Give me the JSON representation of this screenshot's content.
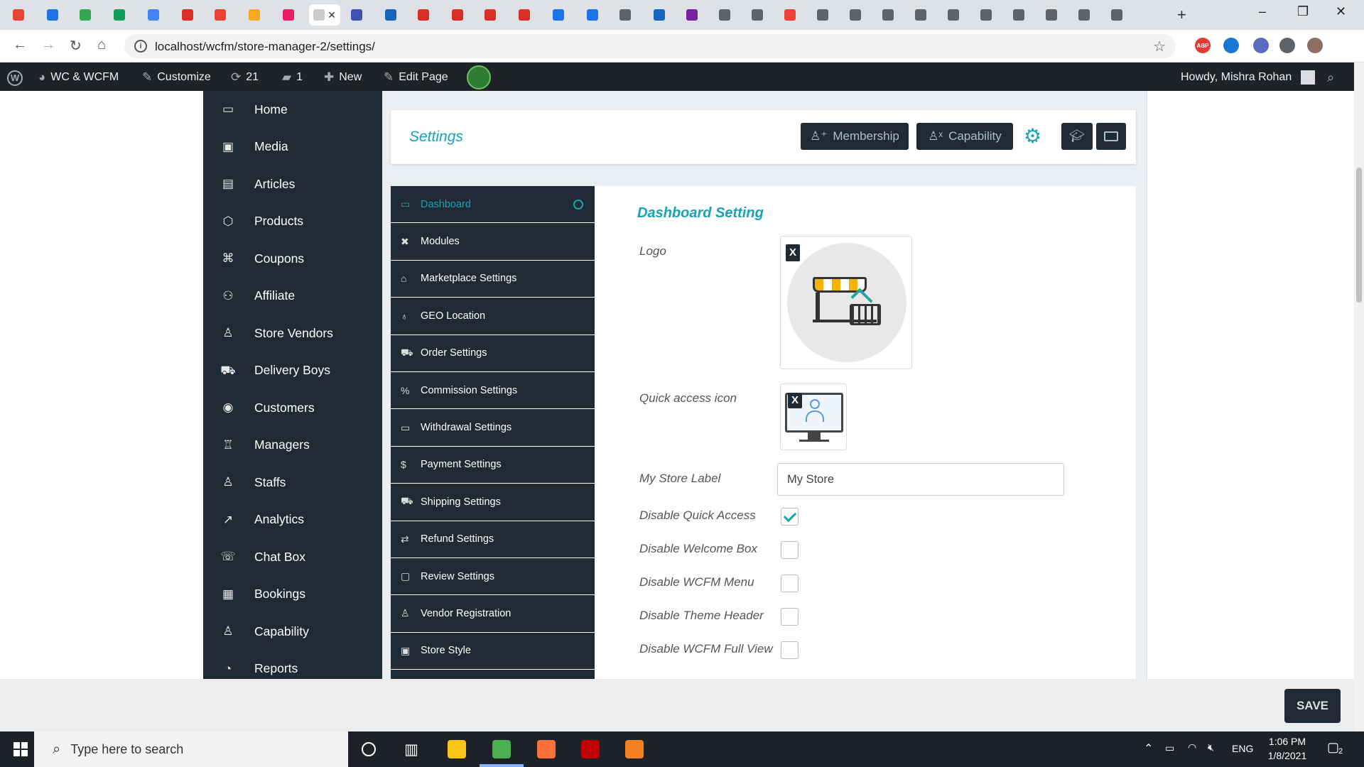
{
  "browser": {
    "active_tab_icon": "close-icon",
    "url": "localhost/wcfm/store-manager-2/settings/",
    "tab_favicons": [
      {
        "color": "#ea4335"
      },
      {
        "color": "#1a73e8"
      },
      {
        "color": "#34a853"
      },
      {
        "color": "#0f9d58"
      },
      {
        "color": "#4285f4"
      },
      {
        "color": "#d93025"
      },
      {
        "color": "#ea4335"
      },
      {
        "color": "#f9a825"
      },
      {
        "color": "#e91e63"
      },
      {
        "color": "#cccccc"
      },
      {
        "color": "#3f51b5"
      },
      {
        "color": "#1565c0"
      },
      {
        "color": "#d93025"
      },
      {
        "color": "#d93025"
      },
      {
        "color": "#d93025"
      },
      {
        "color": "#d93025"
      },
      {
        "color": "#1a73e8"
      },
      {
        "color": "#1a73e8"
      },
      {
        "color": "#5f6368"
      },
      {
        "color": "#1565c0"
      },
      {
        "color": "#7b1fa2"
      },
      {
        "color": "#5f6368"
      },
      {
        "color": "#5f6368"
      },
      {
        "color": "#ea4335"
      },
      {
        "color": "#5f6368"
      },
      {
        "color": "#5f6368"
      },
      {
        "color": "#5f6368"
      },
      {
        "color": "#5f6368"
      },
      {
        "color": "#5f6368"
      },
      {
        "color": "#5f6368"
      },
      {
        "color": "#5f6368"
      },
      {
        "color": "#5f6368"
      },
      {
        "color": "#5f6368"
      },
      {
        "color": "#5f6368"
      }
    ],
    "extensions": [
      {
        "name": "adblock-icon",
        "color": "#e53935",
        "label": "ABP"
      },
      {
        "name": "screenshot-extension-icon",
        "color": "#1976d2",
        "label": ""
      },
      {
        "name": "color-extension-icon",
        "color": "#5c6bc0",
        "label": ""
      },
      {
        "name": "puzzle-extensions-icon",
        "color": "#5f6368",
        "label": ""
      },
      {
        "name": "profile-avatar-icon",
        "color": "#8d6e63",
        "label": ""
      }
    ]
  },
  "wpbar": {
    "site_name": "WC & WCFM",
    "customize": "Customize",
    "updates": "21",
    "comments": "1",
    "new": "New",
    "edit_page": "Edit Page",
    "howdy": "Howdy, Mishra Rohan"
  },
  "sidebar": {
    "items": [
      {
        "label": "Home",
        "icon": "monitor-icon",
        "glyph": "▭"
      },
      {
        "label": "Media",
        "icon": "image-icon",
        "glyph": "▣"
      },
      {
        "label": "Articles",
        "icon": "document-icon",
        "glyph": "▤"
      },
      {
        "label": "Products",
        "icon": "cube-icon",
        "glyph": "⬡"
      },
      {
        "label": "Coupons",
        "icon": "gift-icon",
        "glyph": "⌘"
      },
      {
        "label": "Affiliate",
        "icon": "users-icon",
        "glyph": "⚇"
      },
      {
        "label": "Store Vendors",
        "icon": "user-icon",
        "glyph": "♙"
      },
      {
        "label": "Delivery Boys",
        "icon": "truck-icon",
        "glyph": "⛟"
      },
      {
        "label": "Customers",
        "icon": "user-circle-icon",
        "glyph": "◉"
      },
      {
        "label": "Managers",
        "icon": "user-tie-icon",
        "glyph": "♖"
      },
      {
        "label": "Staffs",
        "icon": "user-icon",
        "glyph": "♙"
      },
      {
        "label": "Analytics",
        "icon": "chart-line-icon",
        "glyph": "↗"
      },
      {
        "label": "Chat Box",
        "icon": "chat-icon",
        "glyph": "☏"
      },
      {
        "label": "Bookings",
        "icon": "calendar-icon",
        "glyph": "▦"
      },
      {
        "label": "Capability",
        "icon": "user-times-icon",
        "glyph": "♙"
      },
      {
        "label": "Reports",
        "icon": "pie-chart-icon",
        "glyph": "◔"
      }
    ]
  },
  "header": {
    "title": "Settings",
    "membership": "Membership",
    "capability": "Capability"
  },
  "tabs": [
    {
      "label": "Dashboard",
      "icon": "monitor-icon",
      "glyph": "▭",
      "active": true
    },
    {
      "label": "Modules",
      "icon": "modules-icon",
      "glyph": "✖",
      "active": false
    },
    {
      "label": "Marketplace Settings",
      "icon": "home-icon",
      "glyph": "⌂",
      "active": false
    },
    {
      "label": "GEO Location",
      "icon": "map-pin-icon",
      "glyph": "♁",
      "active": false
    },
    {
      "label": "Order Settings",
      "icon": "cart-icon",
      "glyph": "⛟",
      "active": false
    },
    {
      "label": "Commission Settings",
      "icon": "percent-icon",
      "glyph": "%",
      "active": false
    },
    {
      "label": "Withdrawal Settings",
      "icon": "credit-card-icon",
      "glyph": "▭",
      "active": false
    },
    {
      "label": "Payment Settings",
      "icon": "dollar-icon",
      "glyph": "$",
      "active": false
    },
    {
      "label": "Shipping Settings",
      "icon": "truck-icon",
      "glyph": "⛟",
      "active": false
    },
    {
      "label": "Refund Settings",
      "icon": "retweet-icon",
      "glyph": "⇄",
      "active": false
    },
    {
      "label": "Review Settings",
      "icon": "comment-icon",
      "glyph": "▢",
      "active": false
    },
    {
      "label": "Vendor Registration",
      "icon": "user-icon",
      "glyph": "♙",
      "active": false
    },
    {
      "label": "Store Style",
      "icon": "image-icon",
      "glyph": "▣",
      "active": false
    }
  ],
  "form": {
    "section_title": "Dashboard Setting",
    "logo_label": "Logo",
    "quick_access_label": "Quick access icon",
    "remove_glyph": "X",
    "store_label_label": "My Store Label",
    "store_label_value": "My Store",
    "checkboxes": [
      {
        "label": "Disable Quick Access",
        "checked": true
      },
      {
        "label": "Disable Welcome Box",
        "checked": false
      },
      {
        "label": "Disable WCFM Menu",
        "checked": false
      },
      {
        "label": "Disable Theme Header",
        "checked": false
      },
      {
        "label": "Disable WCFM Full View",
        "checked": false
      }
    ]
  },
  "save": "SAVE",
  "taskbar": {
    "search_placeholder": "Type here to search",
    "apps": [
      {
        "name": "file-explorer-icon",
        "color": "#f9c31a"
      },
      {
        "name": "chrome-icon",
        "color": "#4caf50"
      },
      {
        "name": "firefox-icon",
        "color": "#ff7139"
      },
      {
        "name": "filezilla-icon",
        "color": "#bf0000"
      },
      {
        "name": "editor-app-icon",
        "color": "#f58220"
      }
    ],
    "language": "ENG",
    "time": "1:06 PM",
    "date": "1/8/2021",
    "notification_count": "2"
  },
  "colors": {
    "accent": "#17a2b8",
    "dark": "#1f2a34",
    "wpbar": "#1d2327"
  }
}
